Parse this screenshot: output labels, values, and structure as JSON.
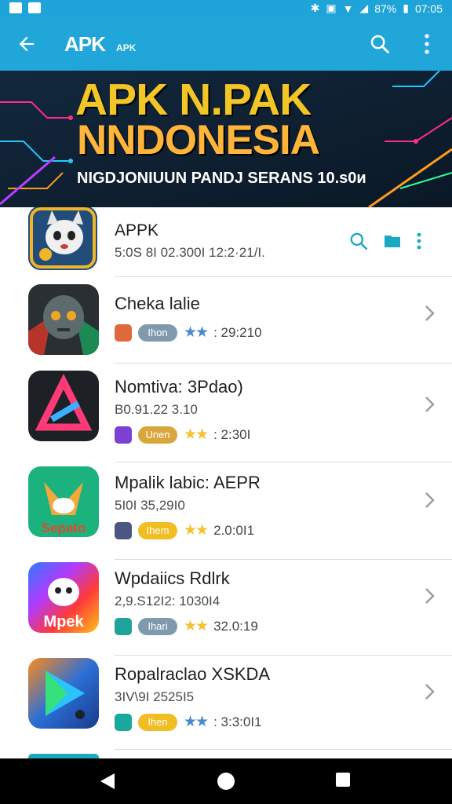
{
  "status_bar": {
    "battery": "87%",
    "time": "07:05"
  },
  "app_bar": {
    "title": "APK",
    "subtitle": "APK"
  },
  "banner": {
    "line1": "APK N.PAK",
    "line2": "NNDONESIA",
    "line3": "NIGDJONIUUN PANDJ SERANS 10.s0и"
  },
  "header_app": {
    "name": "APPK",
    "meta": "5:0S 8I 02.300I 12:2·21/I."
  },
  "apps": [
    {
      "name": "Cheka lalie",
      "meta": "",
      "badge_label": "Ihon",
      "rating": ": 29:210",
      "badge_color": "#e0693b",
      "pill_color": "#7f99ad",
      "stars_color": "#4a88d0"
    },
    {
      "name": "Nomtiva: 3Pdao)",
      "meta": "B0.91.22 3.10",
      "badge_label": "Unen",
      "rating": ": 2:30I",
      "badge_color": "#7c40d3",
      "pill_color": "#d8a73b",
      "stars_color": "#f1c232"
    },
    {
      "name": "Mpalik labic: AEPR",
      "meta": "5I0I 35,29I0",
      "badge_label": "Ihem",
      "rating": "2.0:0I1",
      "badge_color": "#4c5682",
      "pill_color": "#f1bd22",
      "stars_color": "#f1c232"
    },
    {
      "name": "Wpdaiics Rdlrk",
      "meta": "2,9.S12I2: 1030I4",
      "badge_label": "Ihari",
      "rating": "32.0:19",
      "badge_color": "#1fa39a",
      "pill_color": "#7f99ad",
      "stars_color": "#f1c232"
    },
    {
      "name": "Ropalraclao XSKDA",
      "meta": "3IV\\9I 2525I5",
      "badge_label": "Ihen",
      "rating": ": 3:3:0I1",
      "badge_color": "#19a79e",
      "pill_color": "#f1bd22",
      "stars_color": "#4a88d0"
    }
  ],
  "colors": {
    "primary": "#21a6da",
    "accent": "#1aa9c1"
  }
}
